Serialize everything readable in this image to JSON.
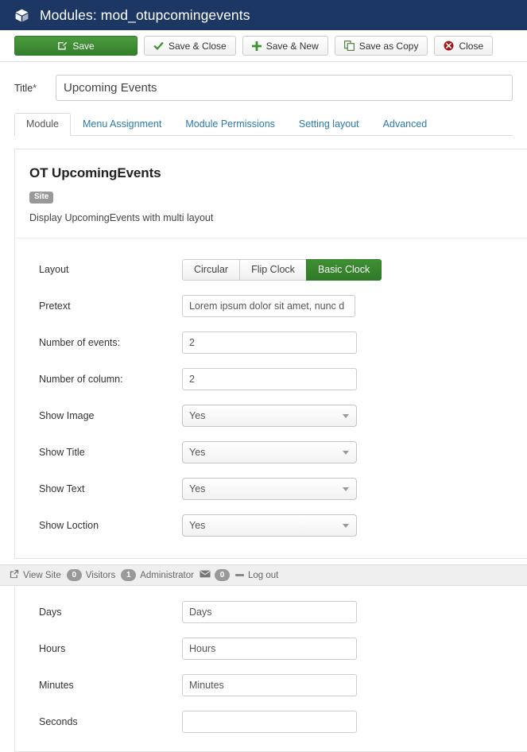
{
  "header": {
    "icon": "cube-icon",
    "title": "Modules: mod_otupcomingevents",
    "bg_color": "#1c3764"
  },
  "toolbar": {
    "buttons": [
      {
        "label": "Save",
        "icon": "edit-square-icon",
        "style": "primary",
        "accent": "#357f2c"
      },
      {
        "label": "Save & Close",
        "icon": "check-icon",
        "style": "default"
      },
      {
        "label": "Save & New",
        "icon": "plus-icon",
        "style": "default"
      },
      {
        "label": "Save as Copy",
        "icon": "copy-icon",
        "style": "default"
      },
      {
        "label": "Close",
        "icon": "close-circle-icon",
        "style": "default"
      }
    ]
  },
  "title_field": {
    "label": "Title",
    "required_marker": "*",
    "value": "Upcoming Events",
    "placeholder": "Title"
  },
  "tabs": [
    {
      "label": "Module",
      "active": true
    },
    {
      "label": "Menu Assignment",
      "active": false
    },
    {
      "label": "Module Permissions",
      "active": false
    },
    {
      "label": "Setting layout",
      "active": false
    },
    {
      "label": "Advanced",
      "active": false
    }
  ],
  "module": {
    "name": "OT UpcomingEvents",
    "badge": "Site",
    "description": "Display UpcomingEvents with multi layout"
  },
  "form": {
    "layout": {
      "label": "Layout",
      "options": [
        {
          "label": "Circular",
          "selected": false
        },
        {
          "label": "Flip Clock",
          "selected": false
        },
        {
          "label": "Basic Clock",
          "selected": true
        }
      ],
      "selected_color": "#2f7a27"
    },
    "fields": [
      {
        "label": "Pretext",
        "type": "text",
        "value": "Lorem ipsum dolor sit amet, nunc d"
      },
      {
        "label": "Number of events:",
        "type": "text",
        "value": "2"
      },
      {
        "label": "Number of column:",
        "type": "text",
        "value": "2"
      },
      {
        "label": "Show Image",
        "type": "select",
        "value": "Yes"
      },
      {
        "label": "Show Title",
        "type": "select",
        "value": "Yes"
      },
      {
        "label": "Show Text",
        "type": "select",
        "value": "Yes"
      },
      {
        "label": "Show Loction",
        "type": "select",
        "value": "Yes"
      }
    ],
    "lower_fields": [
      {
        "label": "Days",
        "type": "text",
        "value": "Days"
      },
      {
        "label": "Hours",
        "type": "text",
        "value": "Hours"
      },
      {
        "label": "Minutes",
        "type": "text",
        "value": "Minutes"
      },
      {
        "label": "Seconds",
        "type": "text",
        "value": ""
      }
    ]
  },
  "statusbar": {
    "view_site": "View Site",
    "visitors_count": "0",
    "visitors_label": "Visitors",
    "admin_count": "1",
    "admin_label": "Administrator",
    "messages_count": "0",
    "logout": "Log out"
  }
}
